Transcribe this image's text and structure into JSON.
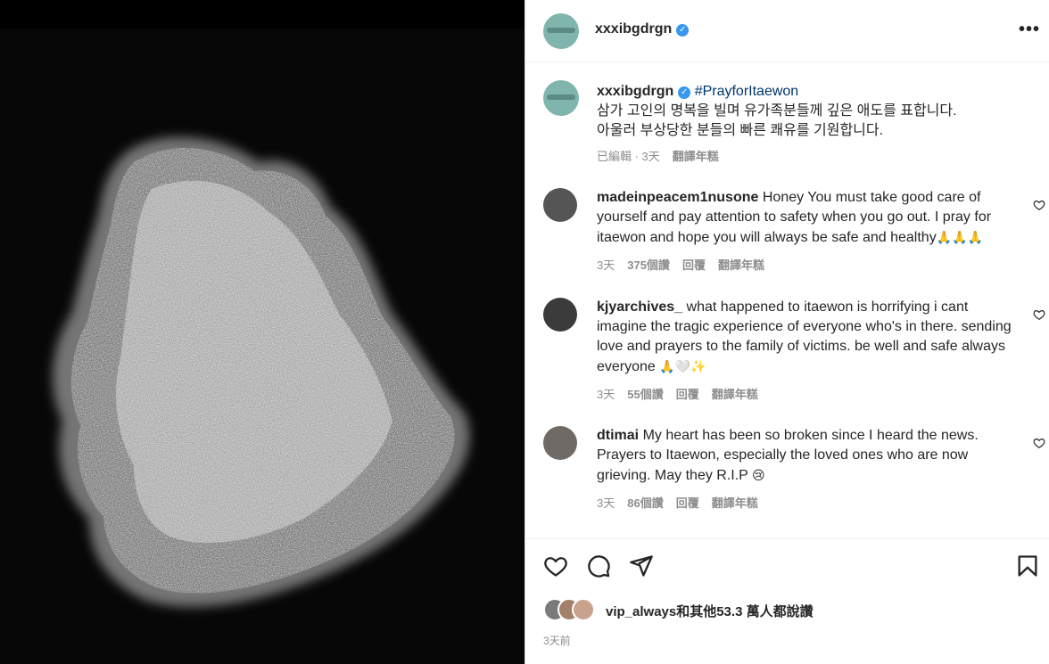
{
  "post": {
    "username": "xxxibgdrgn",
    "verified_mark": "✓",
    "more_label": "•••",
    "caption": {
      "username": "xxxibgdrgn",
      "hashtag": "#PrayforItaewon",
      "line1": "삼가 고인의 명복을 빌며 유가족분들께 깊은 애도를 표합니다.",
      "line2": "아울러 부상당한 분들의 빠른 쾌유를 기원합니다.",
      "meta_edited": "已編輯 · 3天",
      "meta_translate": "翻譯年糕"
    },
    "comments": [
      {
        "username": "madeinpeacem1nusone",
        "text": "Honey You must take good care of yourself and pay attention to safety when you go out. I pray for itaewon and hope you will always be safe and healthy",
        "emoji": "🙏🙏🙏",
        "time": "3天",
        "likes": "375個讚",
        "reply": "回覆",
        "translate": "翻譯年糕",
        "avatar_color": "#5a5a5a"
      },
      {
        "username": "kjyarchives_",
        "text": "what happened to itaewon is horrifying i cant imagine the tragic experience of everyone who's in there. sending love and prayers to the family of victims. be well and safe always everyone",
        "emoji": "🙏🤍✨",
        "time": "3天",
        "likes": "55個讚",
        "reply": "回覆",
        "translate": "翻譯年糕",
        "avatar_color": "#3b3b3b"
      },
      {
        "username": "dtimai",
        "text": "My heart has been so broken since I heard the news. Prayers to Itaewon, especially the loved ones who are now grieving. May they R.I.P",
        "emoji": "😢",
        "time": "3天",
        "likes": "86個讚",
        "reply": "回覆",
        "translate": "翻譯年糕",
        "avatar_color": "#6f6a66"
      }
    ],
    "likes_text": "vip_always和其他53.3 萬人都說讚",
    "date": "3天前",
    "icons": {
      "like": "heart-icon",
      "comment": "comment-icon",
      "share": "share-icon",
      "save": "bookmark-icon"
    },
    "colors": {
      "verified": "#3897f0",
      "hashtag": "#00376b",
      "avatar_main": "#7fb5ad"
    }
  }
}
